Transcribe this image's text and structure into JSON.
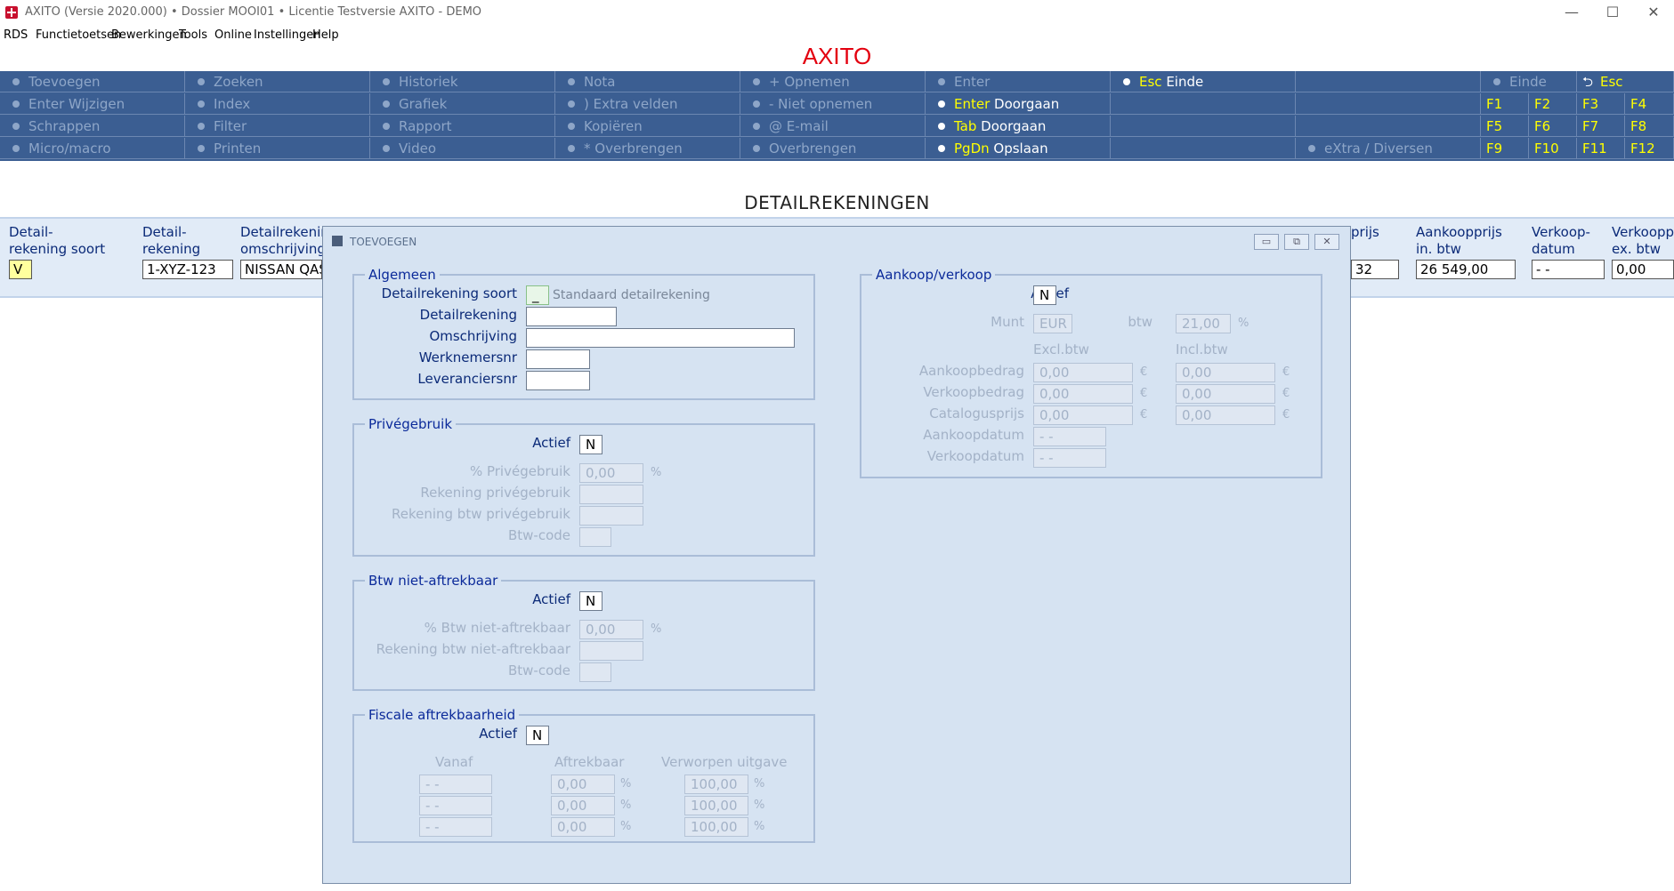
{
  "window": {
    "title": "AXITO  (Versie 2020.000)  •  Dossier MOOI01  •  Licentie Testversie AXITO - DEMO",
    "minimize": "—",
    "maximize": "☐",
    "close": "✕"
  },
  "menu": [
    "RDS",
    "Functietoetsen",
    "Bewerkingen",
    "Tools",
    "Online",
    "Instellingen",
    "Help"
  ],
  "app_title": "AXITO",
  "toolbar": {
    "row1": [
      "Toevoegen",
      "Zoeken",
      "Historiek",
      "Nota",
      "+  Opnemen",
      "Enter"
    ],
    "row1_esc_key": "Esc",
    "row1_esc_label": " Einde",
    "row1_einde": "Einde",
    "row1_back": "Esc",
    "row2": [
      "Enter Wijzigen",
      "Index",
      "Grafiek",
      ") Extra velden",
      "-  Niet opnemen"
    ],
    "row2_key": "Enter",
    "row2_label": " Doorgaan",
    "row3": [
      "Schrappen",
      "Filter",
      "Rapport",
      "Kopiëren",
      "@ E-mail"
    ],
    "row3_key": "Tab",
    "row3_label": " Doorgaan",
    "row4": [
      "Micro/macro",
      "Printen",
      "Video",
      "*  Overbrengen",
      "Overbrengen"
    ],
    "row4_key": "PgDn",
    "row4_label": " Opslaan",
    "row4_extra": "eXtra / Diversen",
    "fkeys": [
      "F1",
      "F2",
      "F3",
      "F4",
      "F5",
      "F6",
      "F7",
      "F8",
      "F9",
      "F10",
      "F11",
      "F12"
    ]
  },
  "section_title": "DETAILREKENINGEN",
  "record": {
    "h_soort": [
      "Detail-",
      "rekening soort"
    ],
    "h_rek": [
      "Detail-",
      "rekening"
    ],
    "h_oms": [
      "Detailrekening",
      "omschrijving"
    ],
    "h_prijs": [
      "prijs",
      ""
    ],
    "h_aank": [
      "Aankoopprijs",
      "in. btw"
    ],
    "h_vdatum": [
      "Verkoop-",
      "datum"
    ],
    "h_vprijs": [
      "Verkoopprijs",
      "ex. btw"
    ],
    "v_soort": "V",
    "v_rek": "1-XYZ-123",
    "v_oms": "NISSAN QASHQAI",
    "v_prijs": "32",
    "v_aank": "26 549,00",
    "v_vdatum": "- -",
    "v_vprijs": "0,00"
  },
  "dialog": {
    "title": "TOEVOEGEN",
    "algemeen": {
      "legend": "Algemeen",
      "soort_label": "Detailrekening soort",
      "soort_value": "_",
      "soort_hint": "Standaard detailrekening",
      "rek_label": "Detailrekening",
      "oms_label": "Omschrijving",
      "werk_label": "Werknemersnr",
      "lev_label": "Leveranciersnr"
    },
    "prive": {
      "legend": "Privégebruik",
      "actief_label": "Actief",
      "actief_value": "N",
      "pct_label": "% Privégebruik",
      "pct_value": "0,00",
      "pct_unit": "%",
      "rek_label": "Rekening privégebruik",
      "rekbtw_label": "Rekening btw privégebruik",
      "btwcode_label": "Btw-code"
    },
    "btw": {
      "legend": "Btw niet-aftrekbaar",
      "actief_label": "Actief",
      "actief_value": "N",
      "pct_label": "% Btw niet-aftrekbaar",
      "pct_value": "0,00",
      "pct_unit": "%",
      "rek_label": "Rekening btw niet-aftrekbaar",
      "btwcode_label": "Btw-code"
    },
    "fiscaal": {
      "legend": "Fiscale aftrekbaarheid",
      "actief_label": "Actief",
      "actief_value": "N",
      "col_vanaf": "Vanaf",
      "col_aftrek": "Aftrekbaar",
      "col_verworpen": "Verworpen uitgave",
      "rows": [
        {
          "vanaf": "- -",
          "aftrek": "0,00",
          "verworpen": "100,00"
        },
        {
          "vanaf": "- -",
          "aftrek": "0,00",
          "verworpen": "100,00"
        },
        {
          "vanaf": "- -",
          "aftrek": "0,00",
          "verworpen": "100,00"
        }
      ],
      "unit": "%"
    },
    "aankoop": {
      "legend": "Aankoop/verkoop",
      "actief_label": "Actief",
      "actief_value": "N",
      "munt_label": "Munt",
      "munt_value": "EUR",
      "btw_label": "btw",
      "btw_value": "21,00",
      "btw_unit": "%",
      "col_excl": "Excl.btw",
      "col_incl": "Incl.btw",
      "aankoopbedrag_label": "Aankoopbedrag",
      "aankoopbedrag_excl": "0,00",
      "aankoopbedrag_incl": "0,00",
      "verkoopbedrag_label": "Verkoopbedrag",
      "verkoopbedrag_excl": "0,00",
      "verkoopbedrag_incl": "0,00",
      "catalogus_label": "Catalogusprijs",
      "catalogus_excl": "0,00",
      "catalogus_incl": "0,00",
      "euro": "€",
      "aankoopdatum_label": "Aankoopdatum",
      "aankoopdatum_value": "- -",
      "verkoopdatum_label": "Verkoopdatum",
      "verkoopdatum_value": "- -"
    }
  }
}
